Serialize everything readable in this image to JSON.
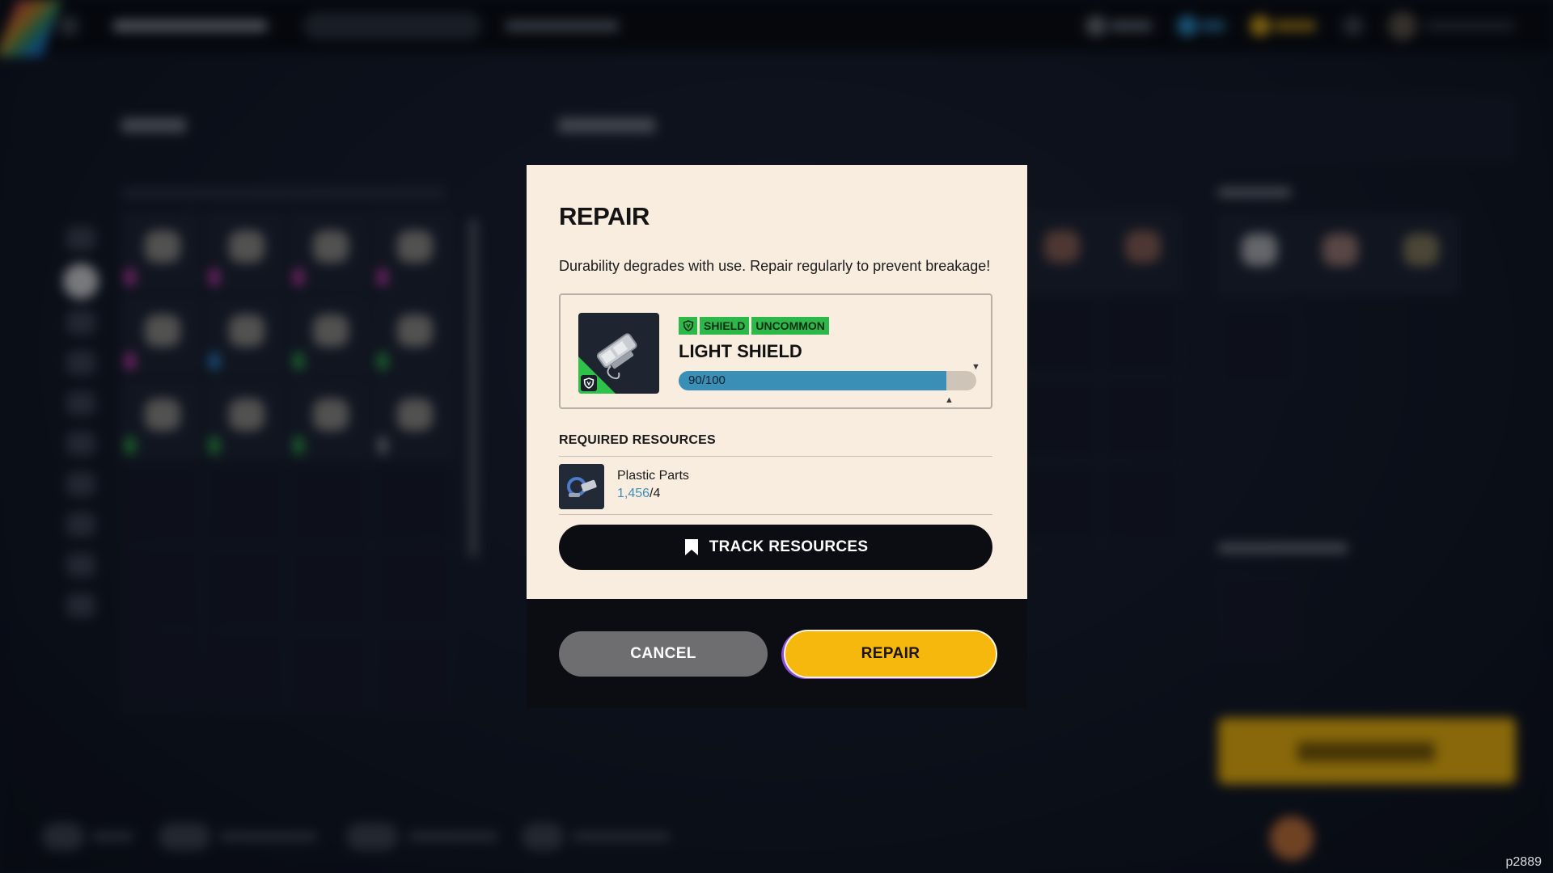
{
  "modal": {
    "title": "REPAIR",
    "description": "Durability degrades with use. Repair regularly to prevent breakage!",
    "item": {
      "category_tag": "SHIELD",
      "rarity_tag": "UNCOMMON",
      "name": "LIGHT SHIELD",
      "durability_text": "90/100",
      "durability_fraction": 0.9
    },
    "required_resources_title": "REQUIRED RESOURCES",
    "resources": [
      {
        "name": "Plastic Parts",
        "have": "1,456",
        "separator": "/",
        "need": "4"
      }
    ],
    "track_label": "TRACK RESOURCES",
    "cancel_label": "CANCEL",
    "confirm_label": "REPAIR"
  },
  "colors": {
    "accent_yellow": "#f6b80c",
    "uncommon_green": "#2fb84a",
    "durability_blue": "#3a8fb7",
    "card_background": "#f9ede0"
  },
  "icons": {
    "shield": "shield-icon",
    "bookmark": "bookmark-icon"
  },
  "watermark": "p2889"
}
